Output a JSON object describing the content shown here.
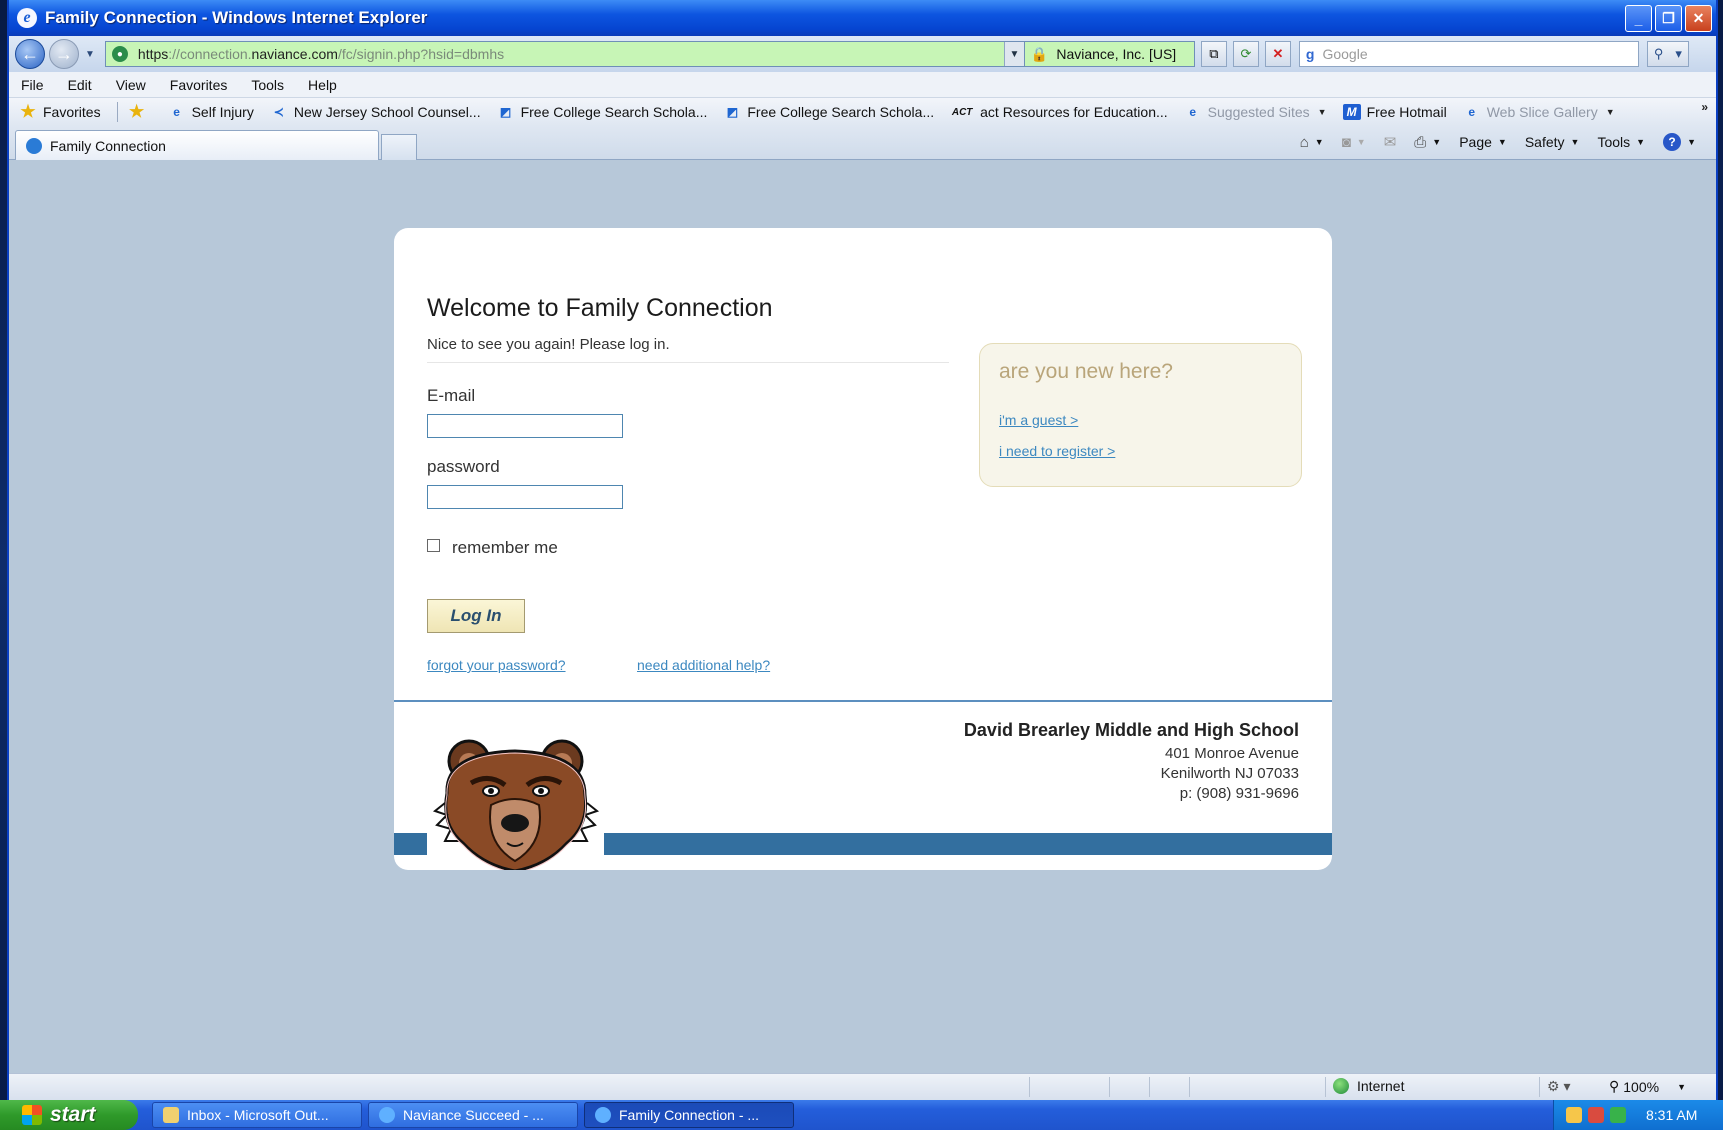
{
  "window": {
    "title": "Family Connection - Windows Internet Explorer",
    "controls": [
      "minimize",
      "restore",
      "close"
    ]
  },
  "address_bar": {
    "url_scheme": "https",
    "url_sep": "://",
    "url_sub": "connection.",
    "url_domain": "naviance.com",
    "url_path": "/fc/signin.php?hsid=dbmhs",
    "certificate": "Naviance, Inc. [US]",
    "search_placeholder": "Google"
  },
  "menu": [
    "File",
    "Edit",
    "View",
    "Favorites",
    "Tools",
    "Help"
  ],
  "favorites_bar": {
    "favorites_label": "Favorites",
    "items": [
      "Self Injury",
      "New Jersey School Counsel...",
      "Free College Search  Schola...",
      "Free College Search  Schola...",
      "act Resources for Education...",
      "Suggested Sites",
      "Free Hotmail",
      "Web Slice Gallery"
    ],
    "act_badge": "ACT"
  },
  "tabs": {
    "active": "Family Connection"
  },
  "command_bar": [
    "Page",
    "Safety",
    "Tools"
  ],
  "login": {
    "title": "Welcome to Family Connection",
    "subtitle": "Nice to see you again! Please log in.",
    "email_label": "E-mail",
    "email_value": "",
    "password_label": "password",
    "password_value": "",
    "remember_label": "remember me",
    "remember_checked": false,
    "login_button": "Log In",
    "forgot_link": "forgot your password?",
    "help_link": "need additional help?"
  },
  "new_here": {
    "title": "are you new here?",
    "guest_link": "i'm a guest >",
    "register_link": "i need to register >"
  },
  "school": {
    "name": "David Brearley Middle and High School",
    "address1": "401 Monroe Avenue",
    "address2": "Kenilworth NJ 07033",
    "phone": "p: (908) 931-9696"
  },
  "status_bar": {
    "zone": "Internet",
    "zoom": "100%"
  },
  "taskbar": {
    "start": "start",
    "tasks": [
      "Inbox - Microsoft Out...",
      "Naviance Succeed - ...",
      "Family Connection - ..."
    ],
    "clock": "8:31 AM"
  },
  "colors": {
    "page_bg": "#b7c8d9",
    "accent_blue": "#336f9f",
    "link": "#3c88c0",
    "address_secure": "#c7f5b6"
  }
}
